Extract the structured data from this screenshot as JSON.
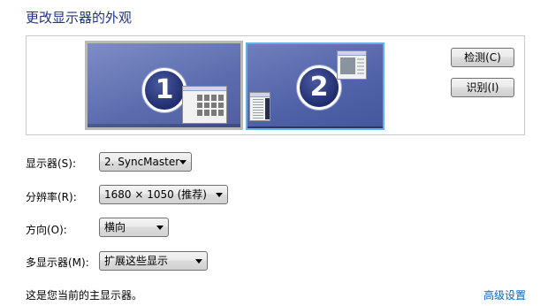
{
  "page": {
    "title": "更改显示器的外观"
  },
  "monitors": [
    {
      "number": "1",
      "selected": false
    },
    {
      "number": "2",
      "selected": true
    }
  ],
  "buttons": {
    "detect": "检测(C)",
    "identify": "识别(I)"
  },
  "fields": {
    "display": {
      "label": "显示器(S):",
      "value": "2. SyncMaster"
    },
    "resolution": {
      "label": "分辨率(R):",
      "value": "1680 × 1050 (推荐)"
    },
    "orientation": {
      "label": "方向(O):",
      "value": "横向"
    },
    "multiple_displays": {
      "label": "多显示器(M):",
      "value": "扩展这些显示"
    }
  },
  "status": {
    "text": "这是您当前的主显示器。"
  },
  "links": {
    "advanced": "高级设置"
  },
  "colors": {
    "title": "#1e3287",
    "link": "#0066cc",
    "selection_border": "#5db3e8"
  },
  "icons": {
    "dropdown": "chevron-down-icon"
  }
}
